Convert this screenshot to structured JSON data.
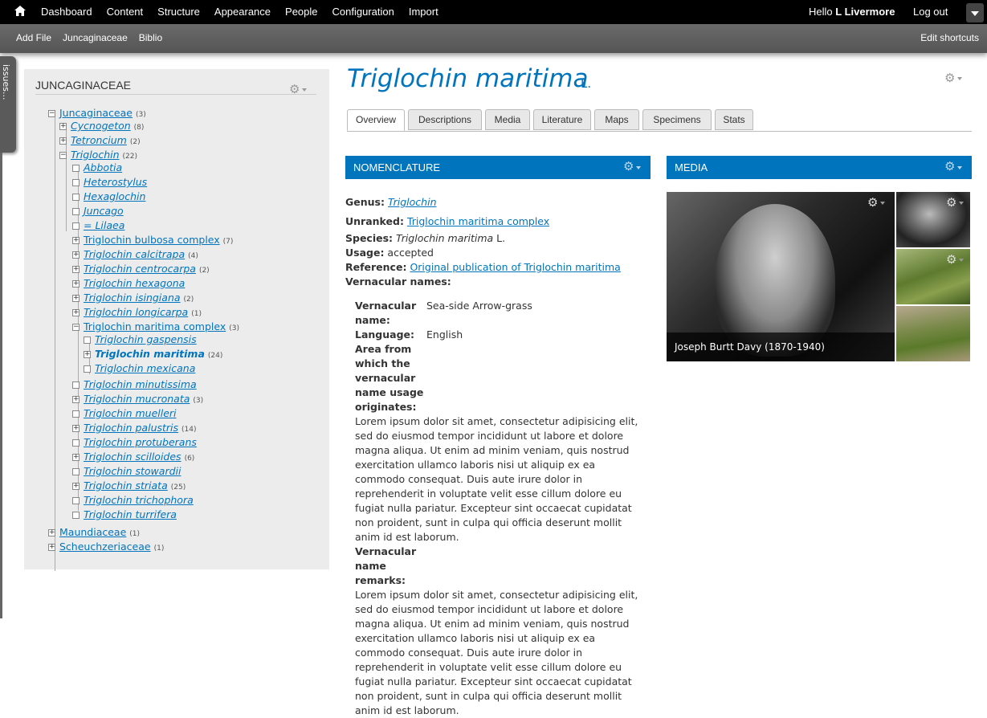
{
  "toolbar": {
    "home_icon": "home-icon",
    "items": [
      "Dashboard",
      "Content",
      "Structure",
      "Appearance",
      "People",
      "Configuration",
      "Import"
    ],
    "hello_prefix": "Hello",
    "user": "L Livermore",
    "logout": "Log out"
  },
  "shortcuts": {
    "items": [
      "Add File",
      "Juncaginaceae",
      "Biblio"
    ],
    "edit": "Edit shortcuts"
  },
  "issues": "issues...",
  "sidebar": {
    "title": "JUNCAGINACEAE",
    "tree": [
      {
        "label": "Juncaginaceae",
        "count": "(3)",
        "level": 0,
        "box": "−"
      },
      {
        "label": "Cycnogeton",
        "count": "(8)",
        "level": 1,
        "box": "+",
        "italic": true
      },
      {
        "label": " Tetroncium",
        "count": "(2)",
        "level": 1,
        "box": "+",
        "italic": true
      },
      {
        "label": "Triglochin",
        "count": "(22)",
        "level": 1,
        "box": "−",
        "italic": true
      },
      {
        "label": " Abbotia",
        "count": "",
        "level": 2,
        "box": "",
        "italic": true
      },
      {
        "label": " Heterostylus",
        "count": "",
        "level": 2,
        "box": "",
        "italic": true
      },
      {
        "label": " Hexaglochin",
        "count": "",
        "level": 2,
        "box": "",
        "italic": true
      },
      {
        "label": " Juncago",
        "count": "",
        "level": 2,
        "box": "",
        "italic": true
      },
      {
        "label": "= Lilaea",
        "count": "",
        "level": 2,
        "box": "",
        "italic": true
      },
      {
        "label": "Triglochin bulbosa complex",
        "count": "(7)",
        "level": 2,
        "box": "+"
      },
      {
        "label": "Triglochin calcitrapa",
        "count": "(4)",
        "level": 2,
        "box": "+",
        "italic": true
      },
      {
        "label": " Triglochin centrocarpa",
        "count": "(2)",
        "level": 2,
        "box": "+",
        "italic": true
      },
      {
        "label": " Triglochin hexagona",
        "count": "",
        "level": 2,
        "box": "+",
        "italic": true
      },
      {
        "label": " Triglochin isingiana",
        "count": "(2)",
        "level": 2,
        "box": "+",
        "italic": true
      },
      {
        "label": " Triglochin longicarpa",
        "count": "(1)",
        "level": 2,
        "box": "+",
        "italic": true
      },
      {
        "label": "Triglochin maritima complex",
        "count": "(3)",
        "level": 2,
        "box": "−"
      },
      {
        "label": " Triglochin gaspensis",
        "count": "",
        "level": 3,
        "box": "",
        "italic": true
      },
      {
        "label": "Triglochin maritima",
        "count": "(24)",
        "level": 3,
        "box": "+",
        "italic": true,
        "bold": true
      },
      {
        "label": " Triglochin mexicana",
        "count": "",
        "level": 3,
        "box": "",
        "italic": true
      },
      {
        "label": " Triglochin minutissima",
        "count": "",
        "level": 2,
        "box": "",
        "italic": true
      },
      {
        "label": " Triglochin mucronata",
        "count": "(3)",
        "level": 2,
        "box": "+",
        "italic": true
      },
      {
        "label": "Triglochin muelleri",
        "count": "",
        "level": 2,
        "box": "",
        "italic": true
      },
      {
        "label": "Triglochin palustris",
        "count": "(14)",
        "level": 2,
        "box": "+",
        "italic": true
      },
      {
        "label": " Triglochin protuberans",
        "count": "",
        "level": 2,
        "box": "",
        "italic": true
      },
      {
        "label": " Triglochin scilloides",
        "count": "(6)",
        "level": 2,
        "box": "+",
        "italic": true
      },
      {
        "label": " Triglochin stowardii",
        "count": "",
        "level": 2,
        "box": "",
        "italic": true
      },
      {
        "label": " Triglochin striata",
        "count": "(25)",
        "level": 2,
        "box": "+",
        "italic": true
      },
      {
        "label": " Triglochin trichophora",
        "count": "",
        "level": 2,
        "box": "",
        "italic": true
      },
      {
        "label": " Triglochin turrifera",
        "count": "",
        "level": 2,
        "box": "",
        "italic": true
      },
      {
        "label": "Maundiaceae",
        "count": "(1)",
        "level": 0,
        "box": "+"
      },
      {
        "label": "Scheuchzeriaceae",
        "count": "(1)",
        "level": 0,
        "box": "+"
      }
    ]
  },
  "page": {
    "title": "Triglochin maritima",
    "author": "L.",
    "tabs": [
      "Overview",
      "Descriptions",
      "Media",
      "Literature",
      "Maps",
      "Specimens",
      "Stats"
    ],
    "active_tab": "Overview"
  },
  "nomenclature": {
    "heading": "NOMENCLATURE",
    "genus_label": "Genus:",
    "genus": "Triglochin",
    "unranked_label": "Unranked:",
    "unranked": "Triglochin maritima complex",
    "species_label": "Species:",
    "species": "Triglochin maritima",
    "species_author": " L.",
    "usage_label": "Usage:",
    "usage": " accepted",
    "reference_label": "Reference:",
    "reference": "Original publication of Triglochin maritima",
    "vernacular_label": "Vernacular names:",
    "vn_name_label": [
      "Vernacular",
      "name:"
    ],
    "vn_name": "Sea-side Arrow-grass",
    "language_label": "Language:",
    "language": "English",
    "area_label": [
      "Area from",
      "which the",
      "vernacular",
      "name usage",
      "originates:"
    ],
    "area_text": "Lorem ipsum dolor sit amet, consectetur adipisicing elit, sed do eiusmod tempor incididunt ut labore et dolore magna aliqua. Ut enim ad minim veniam, quis nostrud exercitation ullamco laboris nisi ut aliquip ex ea commodo consequat. Duis aute irure dolor in reprehenderit in voluptate velit esse cillum dolore eu fugiat nulla pariatur. Excepteur sint occaecat cupidatat non proident, sunt in culpa qui officia deserunt mollit anim id est laborum.",
    "remarks_label": [
      "Vernacular",
      "name",
      "remarks:"
    ],
    "remarks_text": "Lorem ipsum dolor sit amet, consectetur adipisicing elit, sed do eiusmod tempor incididunt ut labore et dolore magna aliqua. Ut enim ad minim veniam, quis nostrud exercitation ullamco laboris nisi ut aliquip ex ea commodo consequat. Duis aute irure dolor in reprehenderit in voluptate velit esse cillum dolore eu fugiat nulla pariatur. Excepteur sint occaecat cupidatat non proident, sunt in culpa qui officia deserunt mollit anim id est laborum."
  },
  "media": {
    "heading": "MEDIA",
    "caption": "Joseph Burtt Davy (1870-1940)"
  },
  "colors": {
    "accent": "#0074bd",
    "toolbar": "#000000",
    "sidebar": "#ececec"
  }
}
